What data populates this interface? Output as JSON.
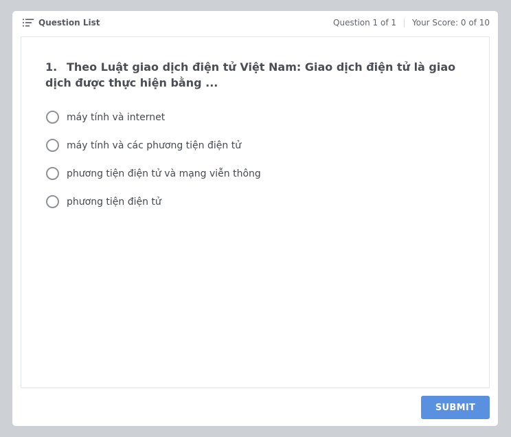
{
  "header": {
    "question_list_label": "Question List",
    "question_counter": "Question 1 of 1",
    "score": "Your Score: 0 of 10"
  },
  "question": {
    "number": "1.",
    "text": "Theo Luật giao dịch điện tử Việt Nam: Giao dịch điện tử là giao dịch được thực hiện bằng ..."
  },
  "answers": [
    {
      "label": "máy tính và internet"
    },
    {
      "label": "máy tính và các phương tiện điện tử"
    },
    {
      "label": "phương tiện điện tử và mạng viễn thông"
    },
    {
      "label": "phương tiện điện tử"
    }
  ],
  "footer": {
    "submit_label": "SUBMIT"
  },
  "colors": {
    "background": "#cdd0d4",
    "submit": "#5a90e0"
  },
  "icons": {
    "question_list": "list-icon",
    "answer_option": "radio-unchecked"
  }
}
